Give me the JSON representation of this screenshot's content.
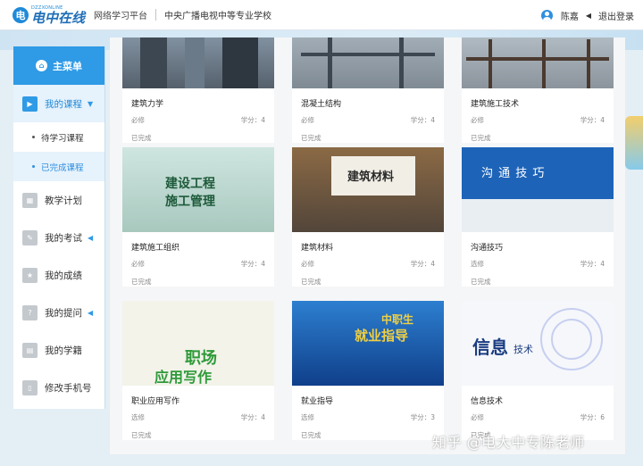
{
  "header": {
    "logo_main": "电中在线",
    "logo_sub": "DZZXONLINE",
    "platform": "网络学习平台",
    "school": "中央广播电视中等专业学校",
    "username": "陈嘉",
    "logout": "退出登录",
    "user_icon": "user-avatar-icon",
    "brand_color": "#2f9ae5"
  },
  "sidebar": {
    "title": "主菜单",
    "items": [
      {
        "label": "我的课程",
        "icon": "play-icon",
        "expanded": true
      },
      {
        "label": "待学习课程"
      },
      {
        "label": "已完成课程",
        "selected": true
      },
      {
        "label": "教学计划",
        "icon": "calendar-icon"
      },
      {
        "label": "我的考试",
        "icon": "exam-icon"
      },
      {
        "label": "我的成绩",
        "icon": "score-icon"
      },
      {
        "label": "我的提问",
        "icon": "question-icon"
      },
      {
        "label": "我的学籍",
        "icon": "student-record-icon"
      },
      {
        "label": "修改手机号",
        "icon": "phone-icon"
      }
    ]
  },
  "courses": [
    {
      "title": "建筑力学",
      "type": "必修",
      "credit": "学分：4",
      "status": "已完成"
    },
    {
      "title": "混凝土结构",
      "type": "必修",
      "credit": "学分：4",
      "status": "已完成"
    },
    {
      "title": "建筑施工技术",
      "type": "必修",
      "credit": "学分：4",
      "status": "已完成"
    },
    {
      "title": "建筑施工组织",
      "type": "必修",
      "credit": "学分：4",
      "status": "已完成",
      "cover_text": [
        "建设工程",
        "施工管理"
      ]
    },
    {
      "title": "建筑材料",
      "type": "必修",
      "credit": "学分：4",
      "status": "已完成",
      "cover_text": [
        "建筑材料"
      ]
    },
    {
      "title": "沟通技巧",
      "type": "选修",
      "credit": "学分：4",
      "status": "已完成",
      "cover_text": [
        "沟 通 技 巧"
      ]
    },
    {
      "title": "职业应用写作",
      "type": "选修",
      "credit": "学分：4",
      "status": "已完成",
      "cover_text": [
        "职场",
        "应用写作"
      ]
    },
    {
      "title": "就业指导",
      "type": "选修",
      "credit": "学分：3",
      "status": "已完成",
      "cover_text": [
        "中职生",
        "就业指导"
      ]
    },
    {
      "title": "信息技术",
      "type": "必修",
      "credit": "学分：6",
      "status": "已完成",
      "cover_text": [
        "信息",
        "技术"
      ]
    }
  ],
  "watermark": "知乎 @电大中专陈老师"
}
